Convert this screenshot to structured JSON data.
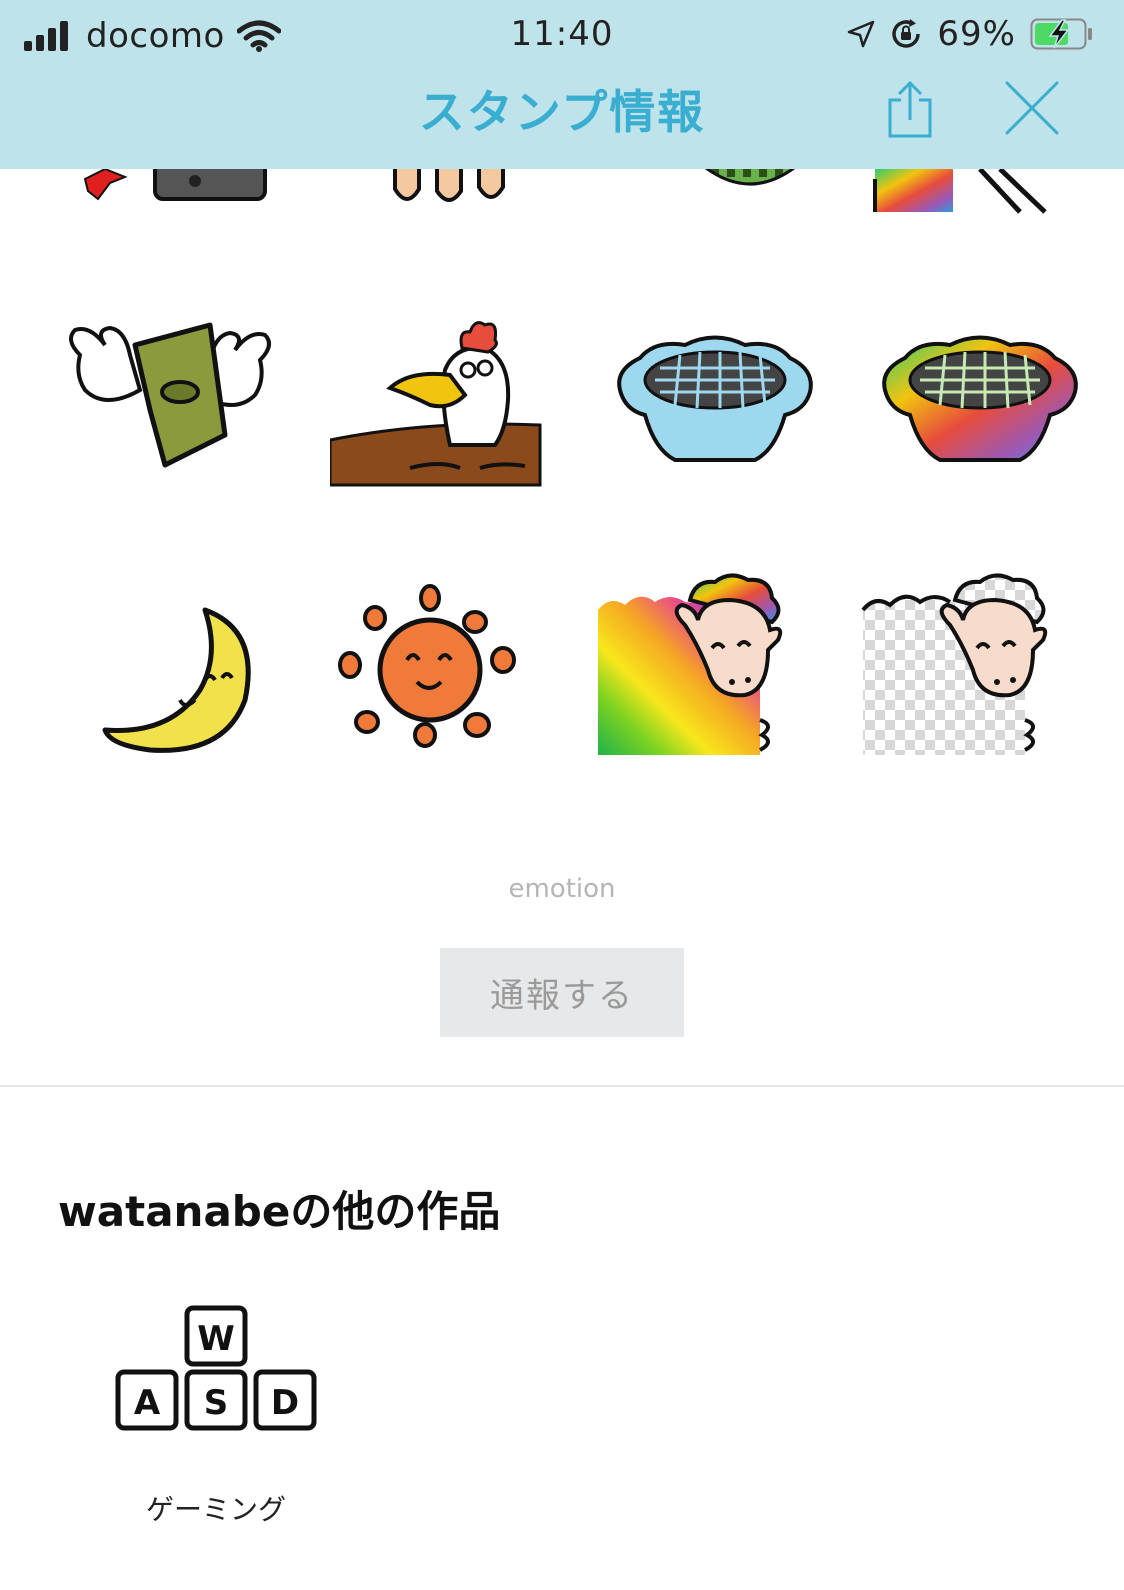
{
  "status_bar": {
    "carrier": "docomo",
    "time": "11:40",
    "battery_percent": "69%",
    "battery_level": 0.69,
    "icons": [
      "signal-bars-icon",
      "wifi-icon",
      "location-arrow-icon",
      "orientation-lock-icon",
      "battery-charging-icon"
    ]
  },
  "nav": {
    "title": "スタンプ情報",
    "actions": [
      "share-icon",
      "close-icon"
    ]
  },
  "stickers": {
    "partial_row": [
      "sticker-red-phone",
      "sticker-hand-fingers",
      "sticker-green-checkered",
      "sticker-rainbow-lines"
    ],
    "row_1": [
      "sticker-flying-money",
      "sticker-rooster",
      "sticker-blue-pie",
      "sticker-rainbow-pie"
    ],
    "row_2": [
      "sticker-smiling-moon",
      "sticker-smiling-sun",
      "sticker-rainbow-sheep",
      "sticker-transparent-sheep"
    ]
  },
  "emotion_label": "emotion",
  "report_button": "通報する",
  "other_works": {
    "title": "watanabeの他の作品",
    "items": [
      {
        "label": "ゲーミング",
        "keys": [
          "W",
          "A",
          "S",
          "D"
        ]
      }
    ]
  },
  "colors": {
    "header_bg": "#bfe3ea",
    "title_color": "#3aaed0",
    "report_bg": "#e7e8e9"
  }
}
